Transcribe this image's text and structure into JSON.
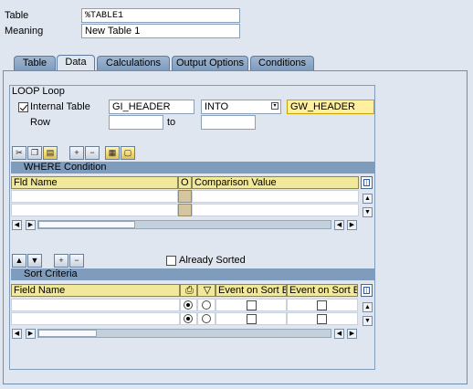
{
  "header": {
    "table_label": "Table",
    "table_value": "%TABLE1",
    "meaning_label": "Meaning",
    "meaning_value": "New Table 1"
  },
  "tabs": [
    {
      "label": "Table",
      "active": false
    },
    {
      "label": "Data",
      "active": true
    },
    {
      "label": "Calculations",
      "active": false
    },
    {
      "label": "Output Options",
      "active": false
    },
    {
      "label": "Conditions",
      "active": false
    }
  ],
  "loop": {
    "group_title": "LOOP Loop",
    "internal_table_label": "Internal Table",
    "internal_table_checked": true,
    "internal_table_value": "GI_HEADER",
    "mode_value": "INTO",
    "work_area_value": "GW_HEADER",
    "row_label": "Row",
    "row_from": "",
    "to_label": "to",
    "row_to": ""
  },
  "where_table": {
    "title": "WHERE Condition",
    "columns": [
      "Fld Name",
      "O",
      "Comparison Value"
    ],
    "rows": [
      [
        "",
        "",
        ""
      ],
      [
        "",
        "",
        ""
      ]
    ]
  },
  "sort": {
    "already_sorted_label": "Already Sorted",
    "already_sorted_checked": false,
    "title": "Sort Criteria",
    "columns": [
      "Field Name",
      "",
      "",
      "Event on Sort B",
      "Event on Sort E"
    ],
    "rows": [
      {
        "field": "",
        "asc": true,
        "desc": false,
        "event_b": false,
        "event_e": false
      },
      {
        "field": "",
        "asc": true,
        "desc": false,
        "event_b": false,
        "event_e": false
      }
    ]
  },
  "icons": {
    "cut": "scissors-icon",
    "copy": "copy-icon",
    "paste": "paste-icon",
    "insert_row": "insert-row-icon",
    "delete_row": "delete-row-icon",
    "select_all": "select-all-icon",
    "deselect_all": "deselect-all-icon",
    "move_up": "arrow-up-icon",
    "move_down": "arrow-down-icon",
    "dropdown": "value-help-icon",
    "table_settings": "table-settings-icon",
    "sort_asc_header": "printer-icon",
    "sort_desc_header": "funnel-icon"
  },
  "colors": {
    "background": "#dfe6ef",
    "table_title": "#7f9cbd",
    "column_header": "#f2e89a",
    "highlight_field": "#ffef9e"
  }
}
